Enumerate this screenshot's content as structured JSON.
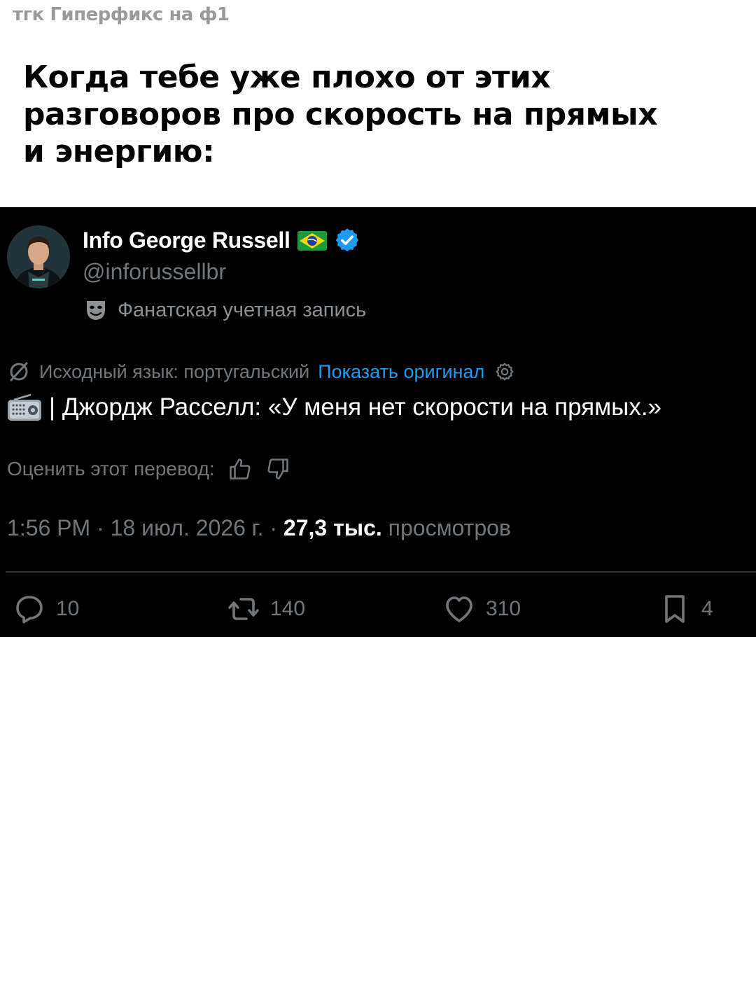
{
  "watermark": "тгк Гиперфикс на ф1",
  "caption": {
    "line1": "Когда тебе уже плохо от этих",
    "line2": "разговоров про скорость на прямых",
    "line3": "и энергию:"
  },
  "tweet": {
    "display_name": "Info George Russell",
    "handle": "@inforussellbr",
    "fan_label": "Фанатская учетная запись",
    "source_language": "Исходный язык: португальский",
    "show_original": "Показать оригинал",
    "text": "| Джордж Расселл: «У меня нет скорости на прямых.»",
    "rate_prompt": "Оценить этот перевод:",
    "timestamp": "1:56 PM · 18 июл. 2026 г. · ",
    "views_count": "27,3 тыс.",
    "views_label": " просмотров",
    "actions": {
      "replies": "10",
      "reposts": "140",
      "likes": "310",
      "bookmarks": "4"
    }
  },
  "colors": {
    "tweet_background": "#000000",
    "link_blue": "#1d9bf0",
    "muted_gray": "#71767b",
    "verified_blue": "#1d9bf0"
  },
  "icons": [
    "brazil-flag-icon",
    "verified-badge-icon",
    "theater-mask-icon",
    "translate-icon",
    "settings-gear-icon",
    "radio-icon",
    "thumbs-up-icon",
    "thumbs-down-icon",
    "reply-icon",
    "repost-icon",
    "like-icon",
    "bookmark-icon"
  ]
}
